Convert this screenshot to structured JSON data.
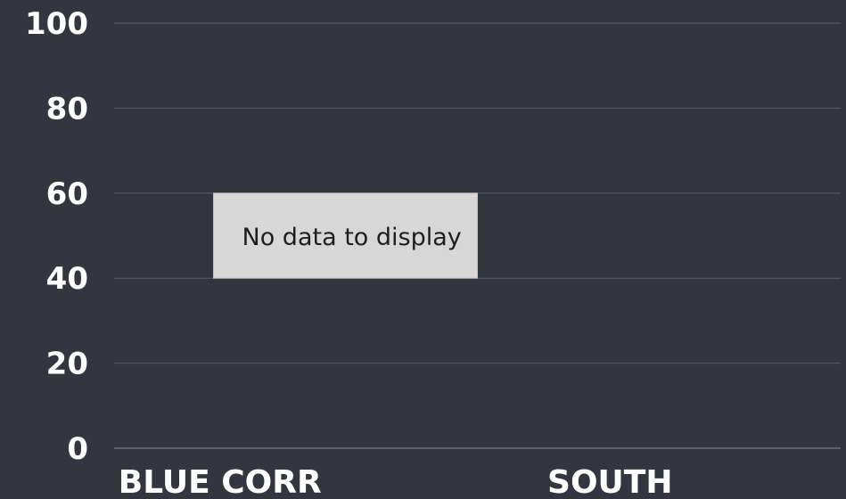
{
  "chart_data": {
    "type": "bar",
    "categories": [
      "BLUE CORR",
      "SOUTH"
    ],
    "values": [],
    "ylim": [
      0,
      100
    ],
    "yticks": [
      0,
      20,
      40,
      60,
      80,
      100
    ],
    "grid": true,
    "message": "No data to display"
  },
  "colors": {
    "background": "#33363e",
    "grid": "#5a5d66",
    "text": "#ffffff",
    "message_box": "#d7d7d7",
    "message_text": "#1e1e1e"
  }
}
